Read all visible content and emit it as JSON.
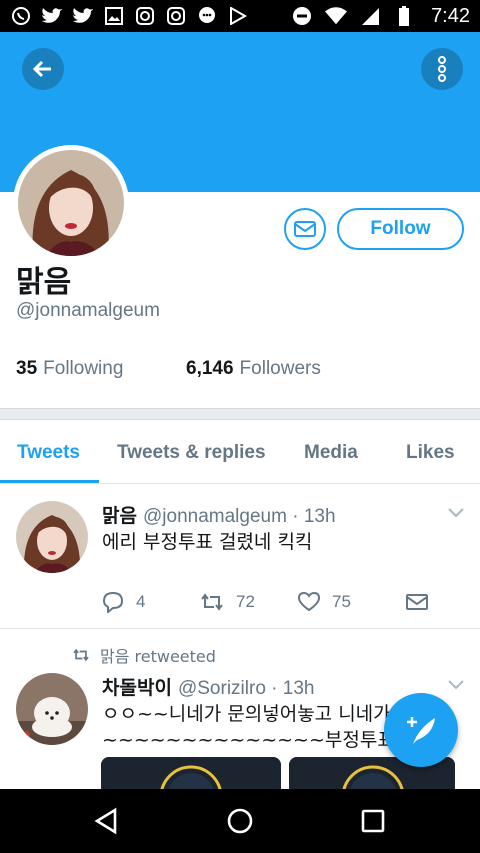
{
  "status_bar": {
    "time": "7:42",
    "left_icons": [
      "whatsapp-icon",
      "twitter-icon",
      "twitter-icon",
      "image-icon",
      "instagram-icon",
      "instagram-icon",
      "chat-icon",
      "play-store-icon"
    ],
    "right_icons": [
      "do-not-disturb-icon",
      "wifi-icon",
      "signal-icon",
      "battery-icon"
    ]
  },
  "colors": {
    "brand": "#1da1f2",
    "banner": "#1da1f2",
    "text_secondary": "#657786"
  },
  "profile": {
    "display_name": "맑음",
    "handle": "@jonnamalgeum",
    "follow_label": "Follow",
    "following_count": "35",
    "following_label": "Following",
    "followers_count": "6,146",
    "followers_label": "Followers"
  },
  "tabs": [
    {
      "label": "Tweets",
      "active": true
    },
    {
      "label": "Tweets & replies",
      "active": false
    },
    {
      "label": "Media",
      "active": false
    },
    {
      "label": "Likes",
      "active": false
    }
  ],
  "tweets": [
    {
      "name": "맑음",
      "meta": "@jonnamalgeum · 13h",
      "text": "에리 부정투표 걸렸네 킥킥",
      "replies": "4",
      "retweets": "72",
      "likes": "75"
    },
    {
      "retweet_label": "맑음 retweeted",
      "name": "차돌박이",
      "meta": "@Sorizilro · 13h",
      "text_line1": "ㅇㅇ~~니네가 문의넣어놓고 니네가",
      "text_line2": "~~~~~~~~~~~~~~부정투표~~"
    }
  ]
}
